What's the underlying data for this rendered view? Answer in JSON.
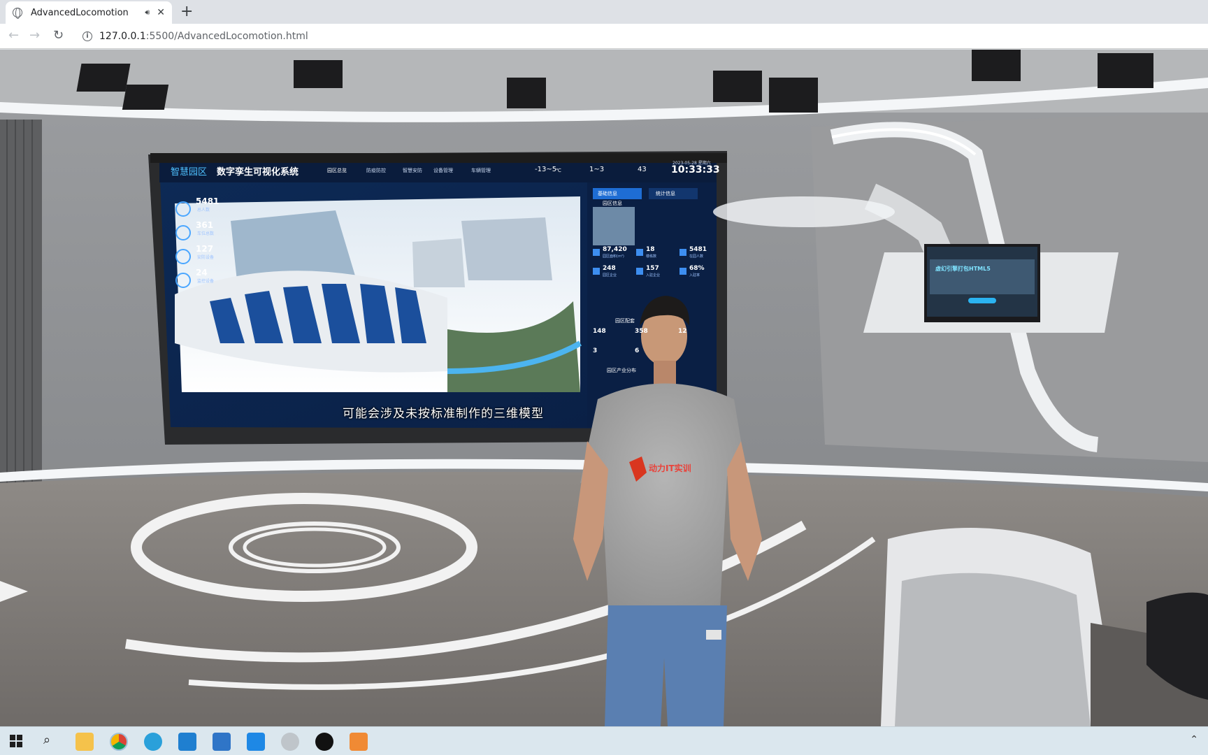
{
  "browser": {
    "tab_title": "AdvancedLocomotion",
    "url_host": "127.0.0.1",
    "url_path": ":5500/AdvancedLocomotion.html"
  },
  "screen": {
    "brand": "智慧园区",
    "system_title": "数字孪生可视化系统",
    "nav": [
      "园区总览",
      "防疫防控",
      "智慧安防",
      "设备管理",
      "车辆管理"
    ],
    "weather_temp": "-13~5",
    "weather_unit": "℃",
    "wind": "1~3",
    "aqi": "43",
    "date": "2023-05-28 星期六",
    "time": "10:33:33",
    "tab_basic": "基础信息",
    "tab_stats": "统计信息",
    "section_park": "园区信息",
    "section_config": "园区配套",
    "section_industry": "园区产业分布",
    "left_stats": [
      {
        "value": "5481",
        "label": "总人数"
      },
      {
        "value": "361",
        "label": "车位总数"
      },
      {
        "value": "127",
        "label": "安防设备"
      },
      {
        "value": "24",
        "label": "监控设备"
      }
    ],
    "right_stats": [
      {
        "value": "87,420",
        "label": "园区面积(m²)"
      },
      {
        "value": "18",
        "label": "楼栋数"
      },
      {
        "value": "5481",
        "label": "在园人数"
      },
      {
        "value": "248",
        "label": "园区企业"
      },
      {
        "value": "157",
        "label": "入驻企业"
      },
      {
        "value": "68%",
        "label": "入驻率"
      },
      {
        "value": "148",
        "label": ""
      },
      {
        "value": "358",
        "label": ""
      },
      {
        "value": "12",
        "label": ""
      },
      {
        "value": "3",
        "label": ""
      },
      {
        "value": "6",
        "label": ""
      }
    ],
    "subtitle": "可能会涉及未按标准制作的三维模型"
  },
  "monitor": {
    "headline": "虚幻引擎打包HTML5"
  },
  "shirt_logo": "动力IT实训"
}
